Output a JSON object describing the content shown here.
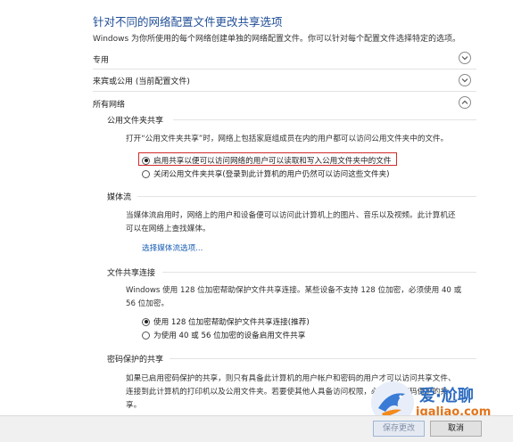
{
  "page": {
    "title": "针对不同的网络配置文件更改共享选项",
    "subtitle": "Windows 为你所使用的每个网络创建单独的网络配置文件。你可以针对每个配置文件选择特定的选项。"
  },
  "profiles": [
    {
      "label": "专用",
      "expanded": false
    },
    {
      "label": "来宾或公用 (当前配置文件)",
      "expanded": false
    },
    {
      "label": "所有网络",
      "expanded": true
    }
  ],
  "public_folder": {
    "heading": "公用文件夹共享",
    "description": "打开“公用文件夹共享”时，网络上包括家庭组成员在内的用户都可以访问公用文件夹中的文件。",
    "options": [
      {
        "label": "启用共享以便可以访问网络的用户可以读取和写入公用文件夹中的文件",
        "selected": true
      },
      {
        "label": "关闭公用文件夹共享(登录到此计算机的用户仍然可以访问这些文件夹)",
        "selected": false
      }
    ]
  },
  "media_streaming": {
    "heading": "媒体流",
    "description_line1": "当媒体流启用时，网络上的用户和设备便可以访问此计算机上的图片、音乐以及视频。此计算机还",
    "description_line2": "可以在网络上查找媒体。",
    "link": "选择媒体流选项..."
  },
  "file_sharing": {
    "heading": "文件共享连接",
    "description_line1": "Windows 使用 128 位加密帮助保护文件共享连接。某些设备不支持 128 位加密，必须使用 40 或",
    "description_line2": "56 位加密。",
    "options": [
      {
        "label": "使用 128 位加密帮助保护文件共享连接(推荐)",
        "selected": true
      },
      {
        "label": "为使用 40 或 56 位加密的设备启用文件共享",
        "selected": false
      }
    ]
  },
  "password_sharing": {
    "heading": "密码保护的共享",
    "description_line1": "如果已启用密码保护的共享，则只有具备此计算机的用户帐户和密码的用户才可以访问共享文件、",
    "description_line2": "连接到此计算机的打印机以及公用文件夹。若要使其他人具备访问权限，必须关闭密码保护的共",
    "description_line3": "享。"
  },
  "footer": {
    "save_label": "保存更改",
    "cancel_label": "取消"
  },
  "watermark": {
    "brand": "爱·尬聊",
    "url": "igaliao.com"
  }
}
